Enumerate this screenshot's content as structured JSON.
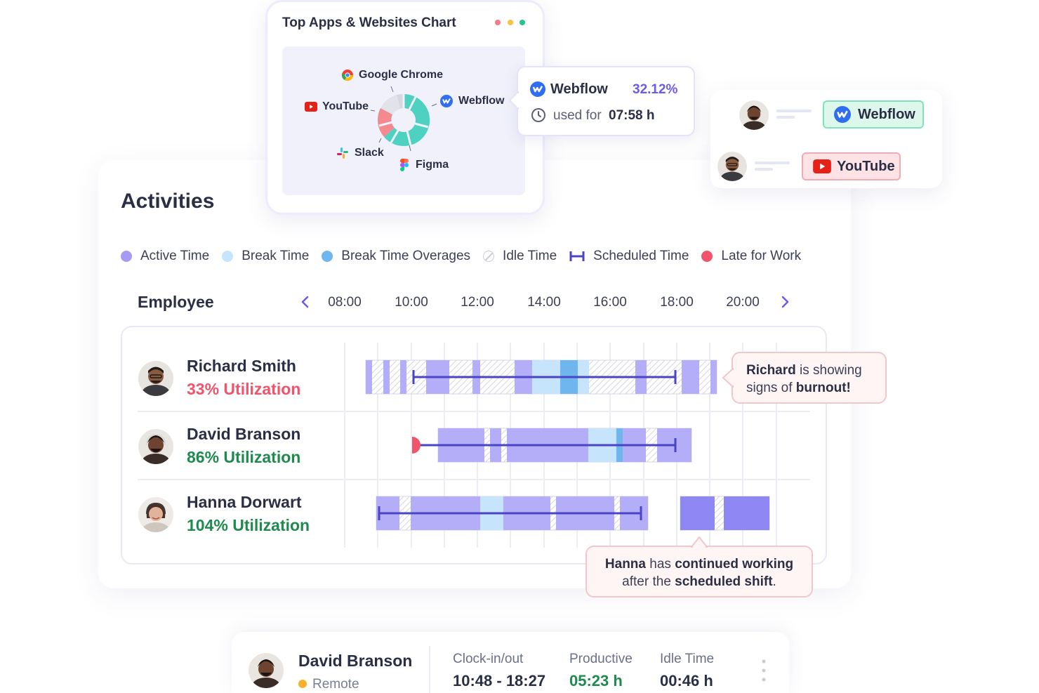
{
  "top_apps": {
    "title": "Top Apps & Websites Chart",
    "window_dots": [
      "#f47b8b",
      "#f6c343",
      "#22c38e"
    ],
    "apps": [
      {
        "name": "Google Chrome",
        "icon": "chrome-icon"
      },
      {
        "name": "YouTube",
        "icon": "youtube-icon"
      },
      {
        "name": "Webflow",
        "icon": "webflow-icon"
      },
      {
        "name": "Slack",
        "icon": "slack-icon"
      },
      {
        "name": "Figma",
        "icon": "figma-icon"
      }
    ]
  },
  "webflow_popup": {
    "app": "Webflow",
    "percent": "32.12%",
    "used_for_label": "used for",
    "duration": "07:58 h"
  },
  "assignments": [
    {
      "app": "Webflow",
      "icon": "webflow-icon",
      "color": "#def7ec",
      "border": "#7fe3b9"
    },
    {
      "app": "YouTube",
      "icon": "youtube-icon",
      "color": "#fde3e6",
      "border": "#f7a9b2"
    }
  ],
  "activities": {
    "title": "Activities",
    "legend": [
      {
        "label": "Active Time",
        "color": "#a59bf5",
        "kind": "dot"
      },
      {
        "label": "Break Time",
        "color": "#c6e4fb",
        "kind": "dot"
      },
      {
        "label": "Break Time Overages",
        "color": "#6fb5ee",
        "kind": "dot"
      },
      {
        "label": "Idle Time",
        "color": "#c9cbd8",
        "kind": "idle"
      },
      {
        "label": "Scheduled Time",
        "color": "#4a45c4",
        "kind": "bracket"
      },
      {
        "label": "Late for Work",
        "color": "#f0546a",
        "kind": "dot"
      }
    ],
    "employee_header": "Employee",
    "time_ticks": [
      "08:00",
      "10:00",
      "12:00",
      "14:00",
      "16:00",
      "18:00",
      "20:00"
    ],
    "employees": [
      {
        "name": "Richard Smith",
        "utilization": "33% Utilization",
        "util_color": "#f0546a"
      },
      {
        "name": "David Branson",
        "utilization": "86% Utilization",
        "util_color": "#1e8a4d"
      },
      {
        "name": "Hanna Dorwart",
        "utilization": "104% Utilization",
        "util_color": "#1e8a4d"
      }
    ],
    "callout_richard": {
      "name": "Richard",
      "text1": " is showing",
      "text2": "signs of ",
      "emph": "burnout!"
    },
    "callout_hanna": {
      "name": "Hanna",
      "text1": " has ",
      "emph1": "continued working",
      "text2": "after the ",
      "emph2": "scheduled shift",
      "end": "."
    }
  },
  "status": {
    "name": "David Branson",
    "location": "Remote",
    "location_dot": "#f6b12a",
    "clock_label": "Clock-in/out",
    "clock_value": "10:48 - 18:27",
    "productive_label": "Productive",
    "productive_value": "05:23 h",
    "idle_label": "Idle Time",
    "idle_value": "00:46 h"
  },
  "colors": {
    "active": "#b4adf7",
    "active_strong": "#8f87f3",
    "break": "#c6e4fb",
    "break_overage": "#6fb5ee",
    "scheduled": "#4a45c4",
    "late": "#f0546a",
    "good": "#1e8a4d",
    "accent": "#6b5ce7"
  }
}
